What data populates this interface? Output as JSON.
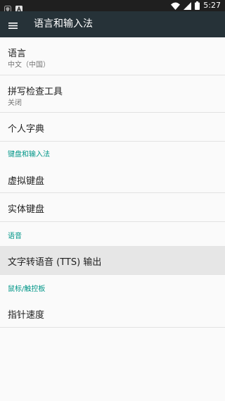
{
  "status_bar": {
    "time": "5:27",
    "left_icons": [
      "shield-icon",
      "font-a-icon"
    ],
    "right_icons": [
      "wifi-icon",
      "cell-signal-icon",
      "battery-icon"
    ]
  },
  "toolbar": {
    "title": "语言和输入法",
    "menu_icon": "menu-icon"
  },
  "items": {
    "language": {
      "title": "语言",
      "summary": "中文（中国）"
    },
    "spell_checker": {
      "title": "拼写检查工具",
      "summary": "关闭"
    },
    "personal_dictionary": {
      "title": "个人字典"
    },
    "category_keyboard": "键盘和输入法",
    "virtual_keyboard": {
      "title": "虚拟键盘"
    },
    "physical_keyboard": {
      "title": "实体键盘"
    },
    "category_speech": "语音",
    "tts_output": {
      "title": "文字转语音 (TTS) 输出"
    },
    "category_mouse": "鼠标/触控板",
    "pointer_speed": {
      "title": "指针速度"
    }
  },
  "colors": {
    "status_bar": "#1f1f1f",
    "toolbar": "#263238",
    "background": "#fafafa",
    "category_accent": "#009688",
    "highlight": "#e6e6e6"
  }
}
